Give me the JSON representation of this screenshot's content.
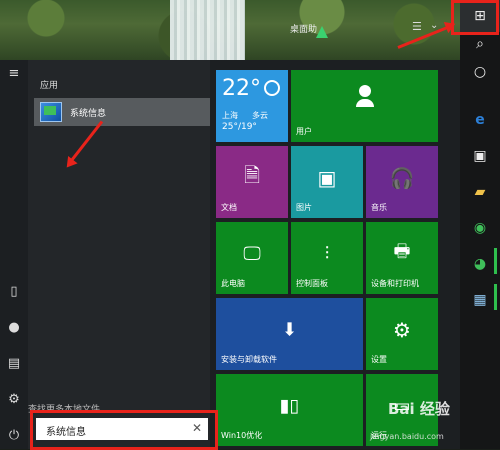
{
  "desktop": {
    "label": "桌面助"
  },
  "start_menu": {
    "section_label": "应用",
    "app_result": {
      "label": "系统信息",
      "icon": "system-information-icon"
    },
    "search_hint": "查找更多本地文件",
    "left_rail_icons": [
      "hamburger-menu-icon",
      "tablet-mode-icon",
      "user-avatar-icon",
      "file-explorer-icon",
      "settings-gear-icon",
      "power-icon"
    ]
  },
  "tiles": {
    "weather": {
      "temp": "22°",
      "city": "上海",
      "condition": "多云",
      "range": "25°/19°"
    },
    "user": "用户",
    "docs": "文档",
    "pics": "图片",
    "music": "音乐",
    "pc": "此电脑",
    "control_panel": "控制面板",
    "printers": "设备和打印机",
    "install": "安装与卸载软件",
    "settings": "设置",
    "win10": "Win10优化",
    "run": "运行"
  },
  "taskbar": {
    "icons": [
      "windows-start-icon",
      "search-icon",
      "cortana-circle-icon",
      "edge-icon",
      "store-icon",
      "file-explorer-icon",
      "green-app-icon",
      "wechat-icon",
      "qq-icon"
    ]
  },
  "search": {
    "value": "系统信息"
  },
  "watermark": {
    "text": "Bai 经验",
    "url": "jingyan.baidu.com"
  },
  "colors": {
    "tile_green": "#0c8a1f",
    "tile_blue": "#2d98e0",
    "annotation_red": "#e8231b"
  }
}
